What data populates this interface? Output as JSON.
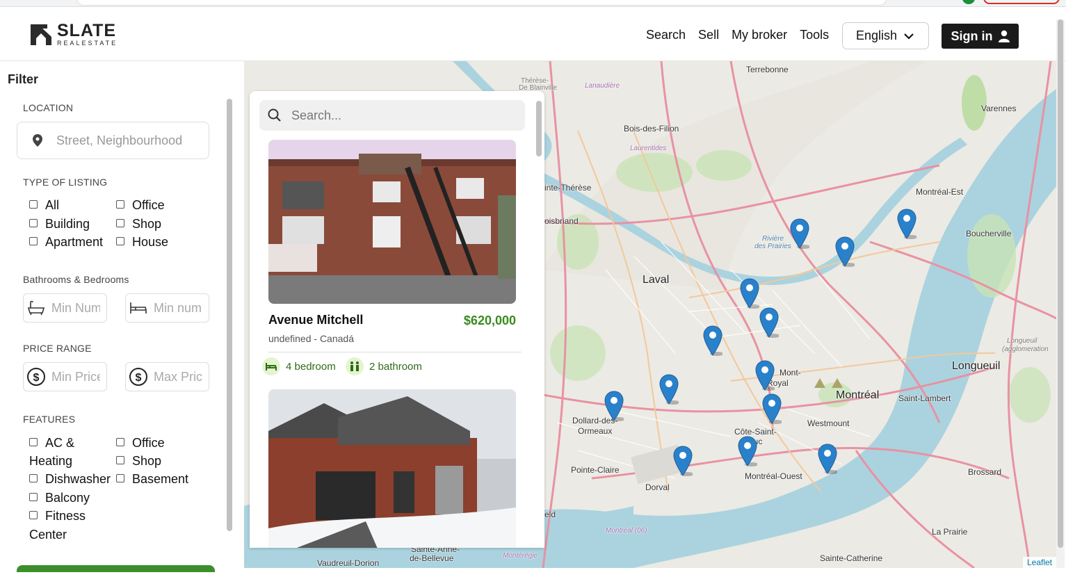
{
  "brand": {
    "name": "SLATE",
    "sub": "REALESTATE"
  },
  "nav": {
    "search": "Search",
    "sell": "Sell",
    "broker": "My broker",
    "tools": "Tools"
  },
  "language": {
    "selected": "English"
  },
  "signin_label": "Sign in",
  "filter": {
    "title": "Filter",
    "location_label": "LOCATION",
    "location_placeholder": "Street, Neighbourhood",
    "type_label": "TYPE OF LISTING",
    "types": [
      "All",
      "Office",
      "Building",
      "Shop",
      "Apartment",
      "House"
    ],
    "bath_bed_label": "Bathrooms & Bedrooms",
    "bath_placeholder": "Min Number",
    "bed_placeholder": "Min number",
    "price_label": "PRICE RANGE",
    "min_price_placeholder": "Min Price",
    "max_price_placeholder": "Max Price",
    "features_label": "FEATURES",
    "features": [
      "AC &",
      "Heating",
      "Office",
      "Shop",
      "Dishwasher",
      "Basement",
      "Balcony",
      "Fitness",
      "Center"
    ]
  },
  "listing": {
    "search_placeholder": "Search...",
    "cards": [
      {
        "title": "Avenue Mitchell",
        "price": "$620,000",
        "location": "undefined - Canadá",
        "bedrooms": "4 bedroom",
        "bathrooms": "2 bathroom"
      }
    ]
  },
  "map": {
    "labels": {
      "terrebonne": "Terrebonne",
      "therese": "Thérèse-",
      "blainville": "De Blainville",
      "bois": "Bois-des-Filion",
      "ste": "inte-Thérèse",
      "boisbriand": "oisbriand",
      "laval": "Laval",
      "riviere": "Rivière",
      "prairies": "des Prairies",
      "varennes": "Varennes",
      "mtlest": "Montréal-Est",
      "boucherville": "Boucherville",
      "longueuil": "Longueuil",
      "longagg": "Longueuil",
      "longagg2": "(agglomeration",
      "montreal": "Montréal",
      "stlambert": "Saint-Lambert",
      "westmount": "Westmount",
      "montroyal": "Mont-",
      "royal": "Royal",
      "csl": "Côte-Saint-",
      "csl2": "Luc",
      "dollard": "Dollard-des-",
      "ormeaux": "Ormeaux",
      "pointe": "Pointe-Claire",
      "dorval": "Dorval",
      "mtlouest": "Montréal-Ouest",
      "brossard": "Brossard",
      "laprairie": "La Prairie",
      "stecath": "Sainte-Catherine",
      "vaudreuil": "Vaudreuil-Dorion",
      "steanne": "Sainte-Anne-",
      "bellevue": "de-Bellevue",
      "monteregie": "Montérégie",
      "mtl06": "Montréal (06)",
      "lanaudiere": "Lanaudière",
      "laurentides": "Laurentides",
      "field": "eld"
    },
    "attribution": "Leaflet",
    "marker_color": "#2a81cb"
  }
}
